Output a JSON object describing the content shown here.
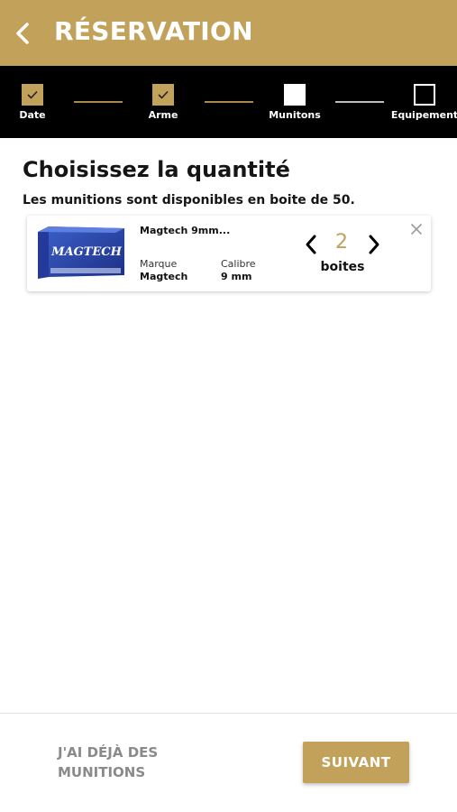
{
  "colors": {
    "accent": "#c2a25a",
    "stepper_bg": "#000000",
    "text": "#151515",
    "muted": "#8a8a8a"
  },
  "header": {
    "title": "RÉSERVATION",
    "back_icon": "chevron-left-icon"
  },
  "stepper": {
    "steps": [
      {
        "label": "Date",
        "state": "done",
        "icon": "check-icon"
      },
      {
        "label": "Arme",
        "state": "done",
        "icon": "check-icon"
      },
      {
        "label": "Munitons",
        "state": "current",
        "icon": ""
      },
      {
        "label": "Equipement",
        "state": "pending",
        "icon": ""
      }
    ]
  },
  "main": {
    "title": "Choisissez la quantité",
    "subtitle": "Les munitions sont disponibles en boite de 50."
  },
  "product": {
    "name": "Magtech 9mm...",
    "brand_label": "Marque",
    "brand_value": "Magtech",
    "caliber_label": "Calibre",
    "caliber_value": "9 mm",
    "quantity": "2",
    "unit": "boites",
    "image_text": "MAGTECH",
    "remove_icon": "close-icon",
    "prev_icon": "chevron-left-icon",
    "next_icon": "chevron-right-icon"
  },
  "footer": {
    "already_have_label": "J'AI DÉJÀ DES MUNITIONS",
    "next_label": "SUIVANT"
  }
}
